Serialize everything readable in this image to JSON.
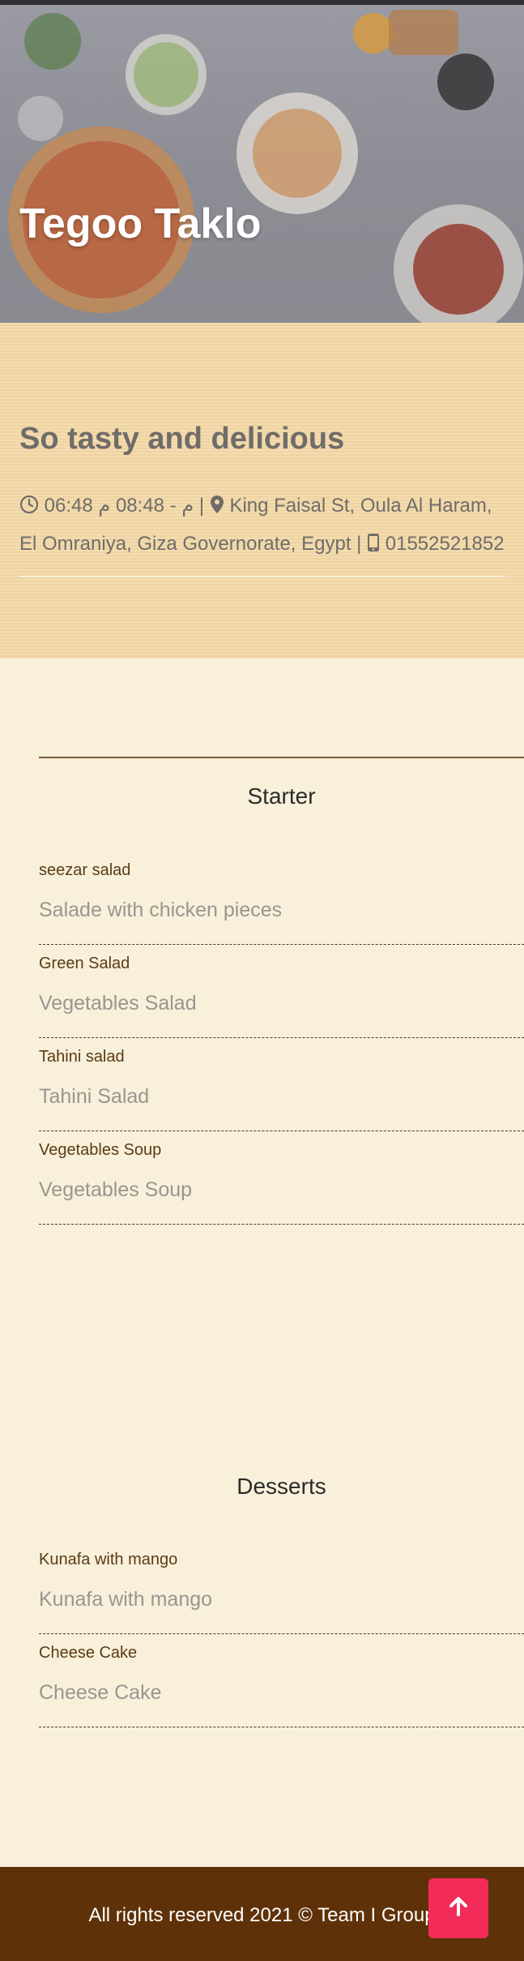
{
  "hero": {
    "title": "Tegoo Taklo"
  },
  "info": {
    "tagline": "So tasty and delicious",
    "hours_text": "06:48 م - 08:48 م",
    "separator": "|",
    "address_line1": "King Faisal St, Oula Al Haram,",
    "address_line2": "El Omraniya, Giza Governorate, Egypt",
    "phone": "01552521852"
  },
  "menu": {
    "sections": [
      {
        "title": "Starter",
        "items": [
          {
            "name": "seezar salad",
            "description": "Salade with chicken pieces"
          },
          {
            "name": "Green Salad",
            "description": "Vegetables Salad"
          },
          {
            "name": "Tahini salad",
            "description": "Tahini Salad"
          },
          {
            "name": "Vegetables Soup",
            "description": "Vegetables Soup"
          }
        ]
      },
      {
        "title": "Desserts",
        "items": [
          {
            "name": "Kunafa with mango",
            "description": "Kunafa with mango"
          },
          {
            "name": "Cheese Cake",
            "description": "Cheese Cake"
          }
        ]
      }
    ]
  },
  "footer": {
    "text": "All rights reserved 2021 © Team I Group"
  },
  "icons": {
    "clock": "clock-icon",
    "location": "map-marker-icon",
    "phone": "mobile-phone-icon",
    "scroll_top": "arrow-up-icon"
  },
  "colors": {
    "accent": "#f22b59",
    "footer": "#5f3108",
    "info_band": "#f3d8a6",
    "page": "#f8f0da"
  }
}
